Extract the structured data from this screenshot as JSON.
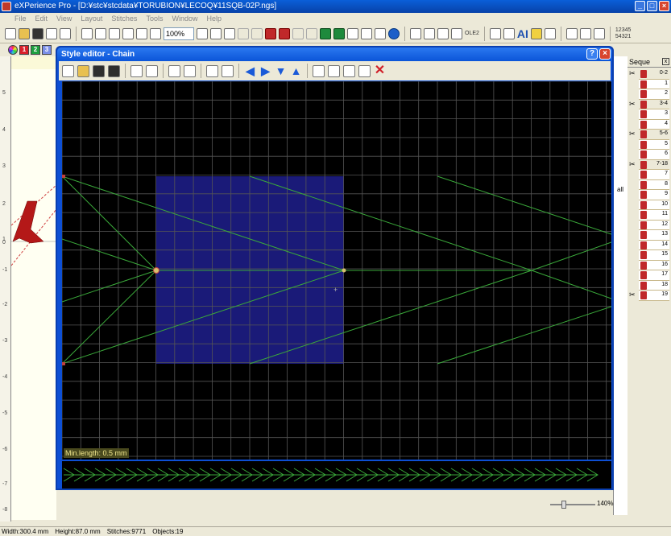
{
  "app": {
    "title": "eXPerience Pro - [D:¥stc¥stcdata¥TORUBION¥LECOQ¥11SQB-02P.ngs]",
    "window_btns": [
      "_",
      "□",
      "×"
    ]
  },
  "menu": [
    "File",
    "Edit",
    "View",
    "Layout",
    "Stitches",
    "Tools",
    "Window",
    "Help"
  ],
  "toolbar": {
    "zoom_value": "100%",
    "ai_label": "AI",
    "counter_top": "12345",
    "counter_bottom": "54321",
    "ole_label": "OLE2"
  },
  "toolbar2": {
    "chips": [
      "1",
      "2",
      "3"
    ]
  },
  "ruler": {
    "numbers": [
      "5",
      "4",
      "3",
      "2",
      "1",
      "0",
      "-1",
      "-2",
      "-3",
      "-4",
      "-5",
      "-6",
      "-7",
      "-8"
    ]
  },
  "style_editor": {
    "title": "Style editor - Chain",
    "help_btn": "?",
    "close_btn": "×",
    "min_length": "Min.length: 0.5 mm"
  },
  "sequence": {
    "header": "Seque",
    "close": "x",
    "items": [
      "0-2",
      "1",
      "2",
      "3-4",
      "3",
      "4",
      "5-6",
      "5",
      "6",
      "7-18",
      "7",
      "8",
      "9",
      "10",
      "11",
      "12",
      "13",
      "14",
      "15",
      "16",
      "17",
      "18",
      "19"
    ],
    "right_strip_label": "all"
  },
  "zoom": {
    "label": "140%"
  },
  "status": {
    "width": "Width:300.4 mm",
    "height": "Height:87.0 mm",
    "stitches": "Stitches:9771",
    "objects": "Objects:19"
  }
}
